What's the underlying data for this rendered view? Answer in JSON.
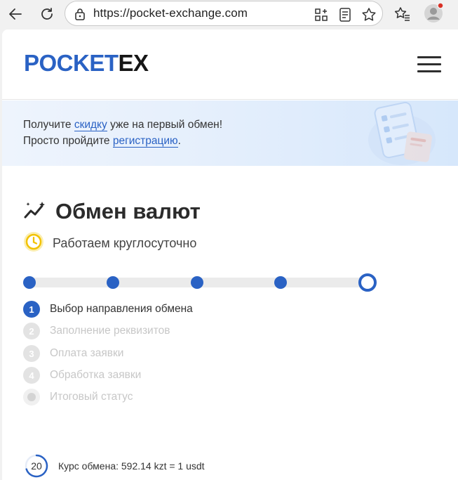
{
  "browser": {
    "url": "https://pocket-exchange.com",
    "icons": [
      "back-arrow-icon",
      "reload-icon",
      "site-info-lock-icon",
      "app-grid-icon",
      "reader-mode-icon",
      "favorite-star-icon",
      "favorites-list-icon",
      "profile-avatar-icon"
    ]
  },
  "header": {
    "logo_part1": "POCKET",
    "logo_part2": "EX",
    "menu_icon": "hamburger-menu-icon"
  },
  "promo": {
    "line1_before": "Получите ",
    "line1_link": "скидку",
    "line1_after": " уже на первый обмен!",
    "line2_before": "Просто пройдите ",
    "line2_link": "регистрацию",
    "line2_after": "."
  },
  "main": {
    "title": "Обмен валют",
    "hours": "Работаем круглосуточно",
    "steps": [
      {
        "num": "1",
        "label": "Выбор направления обмена",
        "active": true
      },
      {
        "num": "2",
        "label": "Заполнение реквизитов",
        "active": false
      },
      {
        "num": "3",
        "label": "Оплата заявки",
        "active": false
      },
      {
        "num": "4",
        "label": "Обработка заявки",
        "active": false
      },
      {
        "num": "",
        "label": "Итоговый статус",
        "active": false
      }
    ],
    "progress_dots": 5
  },
  "rate": {
    "timer": "20",
    "text": "Курс обмена: 592.14 kzt = 1 usdt"
  },
  "colors": {
    "accent": "#2a62c4",
    "clock": "#f2c200"
  }
}
